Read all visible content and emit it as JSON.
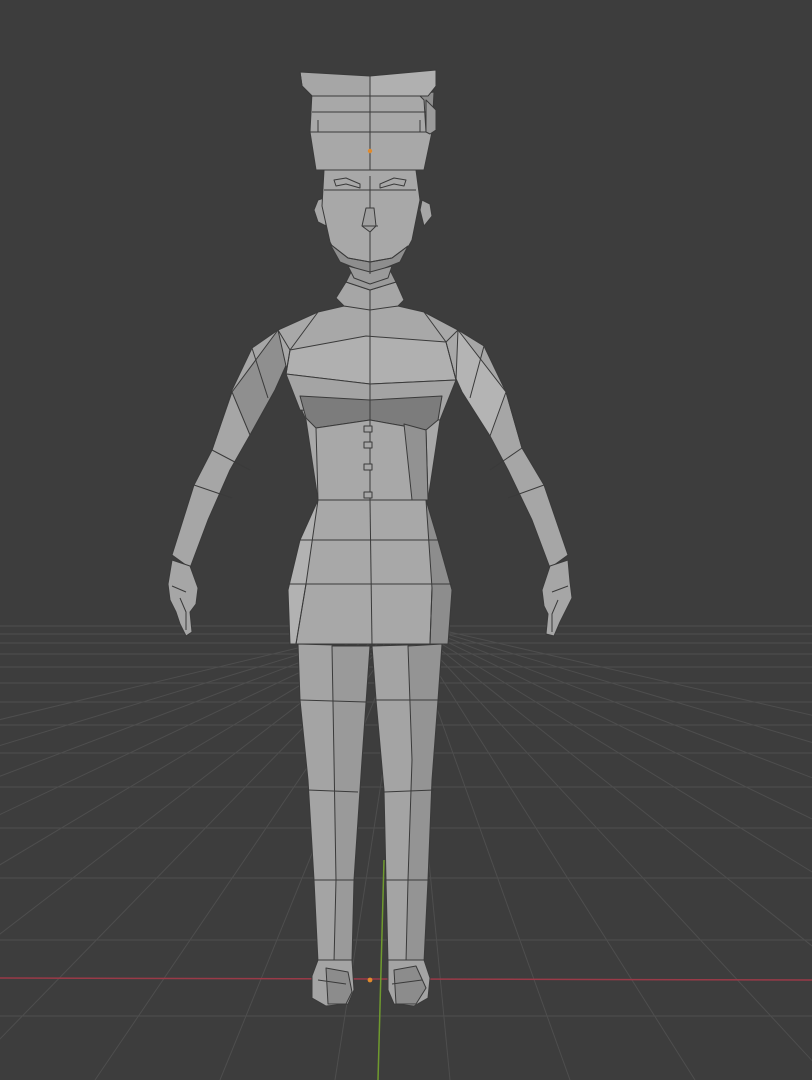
{
  "viewport": {
    "background": "#3d3d3d",
    "grid_color": "#4e4e4e",
    "x_axis_color": "#9a3a48",
    "y_axis_color": "#6f9a2e",
    "origin_color": "#e08a2c"
  },
  "model": {
    "fill": "#a4a4a4",
    "light_fill": "#b4b4b4",
    "shadow_fill": "#8c8c8c",
    "edge_color": "#3a3a3a",
    "face_icons": [
      "eyebrow-shape",
      "nose-shape",
      "mouth-shape"
    ]
  }
}
